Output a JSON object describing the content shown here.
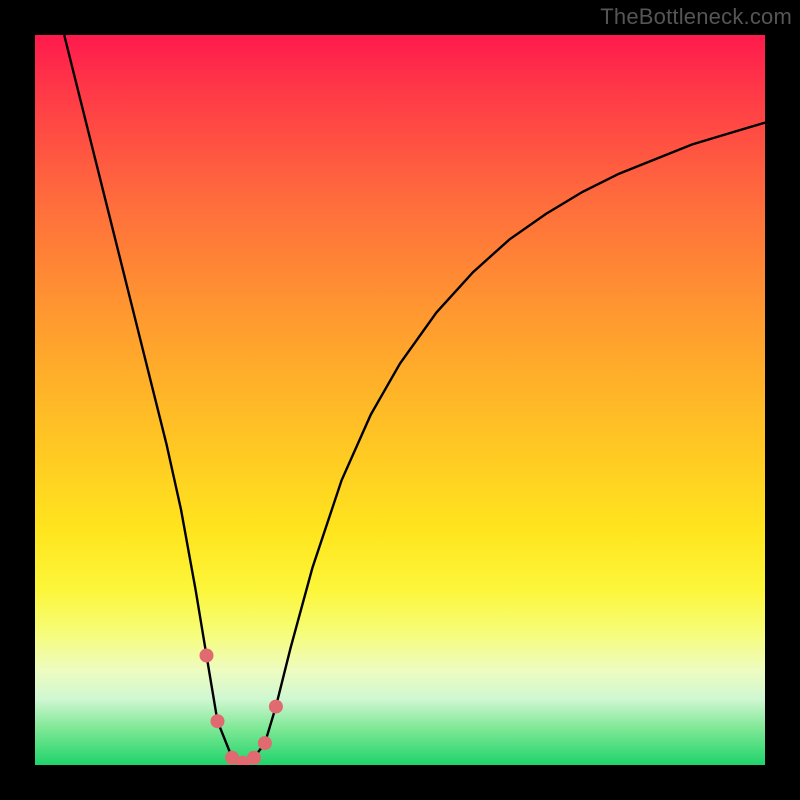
{
  "watermark": "TheBottleneck.com",
  "chart_data": {
    "type": "line",
    "title": "",
    "xlabel": "",
    "ylabel": "",
    "xlim": [
      0,
      100
    ],
    "ylim": [
      0,
      100
    ],
    "grid": false,
    "legend": false,
    "series": [
      {
        "name": "curve",
        "x": [
          4,
          6,
          8,
          10,
          12,
          14,
          16,
          18,
          20,
          22,
          23.5,
          25,
          27,
          28.5,
          30,
          31.5,
          33,
          35,
          38,
          42,
          46,
          50,
          55,
          60,
          65,
          70,
          75,
          80,
          85,
          90,
          95,
          100
        ],
        "y": [
          100,
          92,
          84,
          76,
          68,
          60,
          52,
          44,
          35,
          24,
          15,
          6,
          1,
          0.3,
          1,
          3,
          8,
          16,
          27,
          39,
          48,
          55,
          62,
          67.5,
          72,
          75.5,
          78.5,
          81,
          83,
          85,
          86.5,
          88
        ]
      }
    ],
    "markers": [
      {
        "x": 23.5,
        "y": 15
      },
      {
        "x": 25.0,
        "y": 6
      },
      {
        "x": 27.0,
        "y": 1
      },
      {
        "x": 28.5,
        "y": 0.3
      },
      {
        "x": 30.0,
        "y": 1
      },
      {
        "x": 31.5,
        "y": 3
      },
      {
        "x": 33.0,
        "y": 8
      }
    ],
    "gradient_stops": [
      {
        "pos": 0,
        "color": "#ff1a4d"
      },
      {
        "pos": 22,
        "color": "#ff6a3d"
      },
      {
        "pos": 55,
        "color": "#ffc424"
      },
      {
        "pos": 82,
        "color": "#f6fd7a"
      },
      {
        "pos": 100,
        "color": "#1fd36b"
      }
    ],
    "marker_color": "#e06a6f",
    "curve_color": "#000000"
  }
}
